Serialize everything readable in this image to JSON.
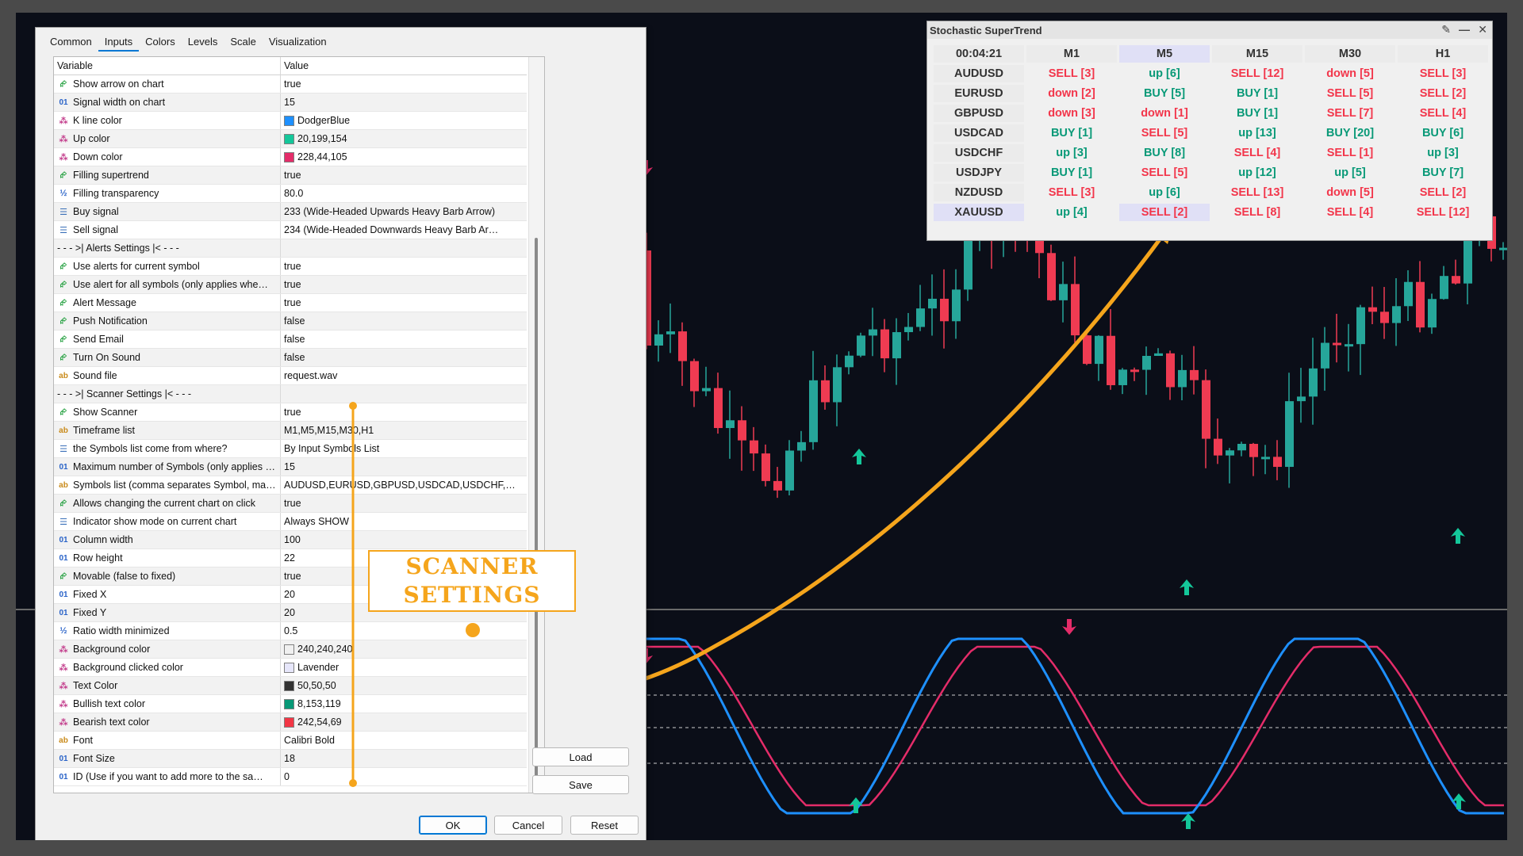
{
  "dialog": {
    "tabs": [
      {
        "label": "Common",
        "active": false
      },
      {
        "label": "Inputs",
        "active": true
      },
      {
        "label": "Colors",
        "active": false
      },
      {
        "label": "Levels",
        "active": false
      },
      {
        "label": "Scale",
        "active": false
      },
      {
        "label": "Visualization",
        "active": false
      }
    ],
    "headers": {
      "variable": "Variable",
      "value": "Value"
    },
    "rows": [
      {
        "icon": "bool",
        "name": "Show arrow on chart",
        "value": "true"
      },
      {
        "icon": "int",
        "name": "Signal width on chart",
        "value": "15"
      },
      {
        "icon": "color",
        "name": "K line color",
        "value": "DodgerBlue",
        "swatch": "#1e90ff"
      },
      {
        "icon": "color",
        "name": "Up color",
        "value": "20,199,154",
        "swatch": "#14c79a"
      },
      {
        "icon": "color",
        "name": "Down color",
        "value": "228,44,105",
        "swatch": "#e42c69"
      },
      {
        "icon": "bool",
        "name": "Filling supertrend",
        "value": "true"
      },
      {
        "icon": "double",
        "name": "Filling transparency",
        "value": "80.0"
      },
      {
        "icon": "enum",
        "name": "Buy signal",
        "value": "233 (Wide-Headed Upwards Heavy Barb Arrow)"
      },
      {
        "icon": "enum",
        "name": "Sell signal",
        "value": "234 (Wide-Headed Downwards Heavy Barb Ar…"
      },
      {
        "icon": "none",
        "name": "- - - >| Alerts Settings |< - - -",
        "value": ""
      },
      {
        "icon": "bool",
        "name": "Use alerts for current symbol",
        "value": "true"
      },
      {
        "icon": "bool",
        "name": "Use alert for all symbols (only applies whe…",
        "value": "true"
      },
      {
        "icon": "bool",
        "name": "Alert Message",
        "value": "true"
      },
      {
        "icon": "bool",
        "name": "Push Notification",
        "value": "false"
      },
      {
        "icon": "bool",
        "name": "Send Email",
        "value": "false"
      },
      {
        "icon": "bool",
        "name": "Turn On Sound",
        "value": "false"
      },
      {
        "icon": "string",
        "name": "Sound file",
        "value": "request.wav"
      },
      {
        "icon": "none",
        "name": "- - - >| Scanner Settings |< - - -",
        "value": ""
      },
      {
        "icon": "bool",
        "name": "Show Scanner",
        "value": "true"
      },
      {
        "icon": "string",
        "name": "Timeframe list",
        "value": "M1,M5,M15,M30,H1"
      },
      {
        "icon": "enum",
        "name": "the Symbols list come from where?",
        "value": "By Input Symbols List"
      },
      {
        "icon": "int",
        "name": "Maximum number of Symbols (only applies …",
        "value": "15"
      },
      {
        "icon": "string",
        "name": "Symbols list (comma separates Symbol, ma…",
        "value": "AUDUSD,EURUSD,GBPUSD,USDCAD,USDCHF,…"
      },
      {
        "icon": "bool",
        "name": "Allows changing the current chart on click",
        "value": "true"
      },
      {
        "icon": "enum",
        "name": "Indicator show mode on current chart",
        "value": "Always SHOW"
      },
      {
        "icon": "int",
        "name": "Column width",
        "value": "100"
      },
      {
        "icon": "int",
        "name": "Row height",
        "value": "22"
      },
      {
        "icon": "bool",
        "name": "Movable (false to fixed)",
        "value": "true"
      },
      {
        "icon": "int",
        "name": "Fixed X",
        "value": "20"
      },
      {
        "icon": "int",
        "name": "Fixed Y",
        "value": "20"
      },
      {
        "icon": "double",
        "name": "Ratio width minimized",
        "value": "0.5"
      },
      {
        "icon": "color",
        "name": "Background color",
        "value": "240,240,240",
        "swatch": "#f0f0f0"
      },
      {
        "icon": "color",
        "name": "Background clicked color",
        "value": "Lavender",
        "swatch": "#e6e6fa"
      },
      {
        "icon": "color",
        "name": "Text Color",
        "value": "50,50,50",
        "swatch": "#323232"
      },
      {
        "icon": "color",
        "name": "Bullish text color",
        "value": "8,153,119",
        "swatch": "#089977"
      },
      {
        "icon": "color",
        "name": "Bearish text color",
        "value": "242,54,69",
        "swatch": "#f23645"
      },
      {
        "icon": "string",
        "name": "Font",
        "value": "Calibri Bold"
      },
      {
        "icon": "int",
        "name": "Font Size",
        "value": "18"
      },
      {
        "icon": "int",
        "name": "ID (Use if you want to add more to the sa…",
        "value": "0"
      }
    ],
    "buttons": {
      "load": "Load",
      "save": "Save",
      "ok": "OK",
      "cancel": "Cancel",
      "reset": "Reset"
    }
  },
  "callout": {
    "line1": "SCANNER",
    "line2": "SETTINGS"
  },
  "scanner": {
    "title": "Stochastic SuperTrend",
    "timer": "00:04:21",
    "timeframes": [
      "M1",
      "M5",
      "M15",
      "M30",
      "H1"
    ],
    "clicked_column": "M5",
    "clicked_row": "XAUUSD",
    "rows": [
      {
        "symbol": "AUDUSD",
        "cells": [
          "SELL [3]",
          "up [6]",
          "SELL [12]",
          "down [5]",
          "SELL [3]"
        ]
      },
      {
        "symbol": "EURUSD",
        "cells": [
          "down [2]",
          "BUY [5]",
          "BUY [1]",
          "SELL [5]",
          "SELL [2]"
        ]
      },
      {
        "symbol": "GBPUSD",
        "cells": [
          "down [3]",
          "down [1]",
          "BUY [1]",
          "SELL [7]",
          "SELL [4]"
        ]
      },
      {
        "symbol": "USDCAD",
        "cells": [
          "BUY [1]",
          "SELL [5]",
          "up [13]",
          "BUY [20]",
          "BUY [6]"
        ]
      },
      {
        "symbol": "USDCHF",
        "cells": [
          "up [3]",
          "BUY [8]",
          "SELL [4]",
          "SELL [1]",
          "up [3]"
        ]
      },
      {
        "symbol": "USDJPY",
        "cells": [
          "BUY [1]",
          "SELL [5]",
          "up [12]",
          "up [5]",
          "BUY [7]"
        ]
      },
      {
        "symbol": "NZDUSD",
        "cells": [
          "SELL [3]",
          "up [6]",
          "SELL [13]",
          "down [5]",
          "SELL [2]"
        ]
      },
      {
        "symbol": "XAUUSD",
        "cells": [
          "up [4]",
          "SELL [2]",
          "SELL [8]",
          "SELL [4]",
          "SELL [12]"
        ]
      }
    ]
  },
  "colors": {
    "bullish": "#089977",
    "bearish": "#f2364b",
    "candle_up": "#26a69a",
    "candle_down": "#ef3b52",
    "k_line": "#1e90ff",
    "up_line": "#14c79a",
    "down_line": "#e42c69",
    "callout": "#f5a51c"
  }
}
